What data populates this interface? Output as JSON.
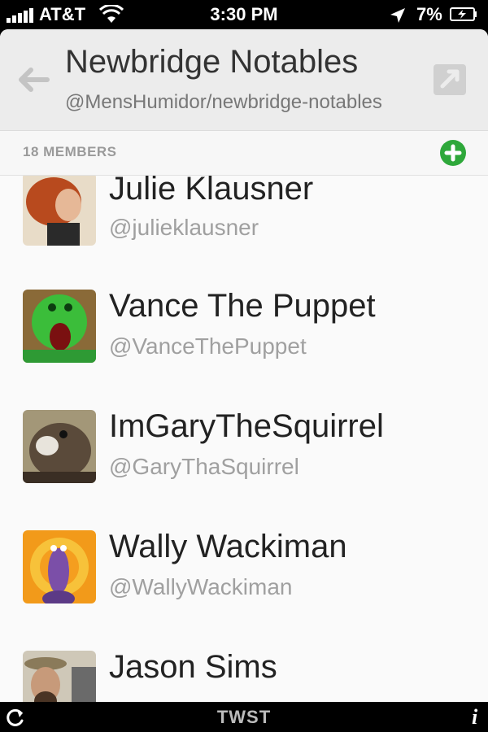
{
  "status_bar": {
    "carrier": "AT&T",
    "time": "3:30 PM",
    "battery": "7%"
  },
  "header": {
    "title": "Newbridge Notables",
    "subtitle": "@MensHumidor/newbridge-notables",
    "back_icon": "back-arrow-icon",
    "share_icon": "external-share-icon"
  },
  "members": {
    "label": "18 MEMBERS",
    "add_icon": "add-circle-icon",
    "add_color": "#2ea83a"
  },
  "list": [
    {
      "name": "Julie Klausner",
      "handle": "@julieklausner"
    },
    {
      "name": "Vance The Puppet",
      "handle": "@VanceThePuppet"
    },
    {
      "name": "ImGaryTheSquirrel",
      "handle": "@GaryThaSquirrel"
    },
    {
      "name": "Wally Wackiman",
      "handle": "@WallyWackiman"
    },
    {
      "name": "Jason Sims",
      "handle": ""
    }
  ],
  "bottom_bar": {
    "app_name": "TWST",
    "refresh_icon": "refresh-icon",
    "info_label": "i"
  }
}
